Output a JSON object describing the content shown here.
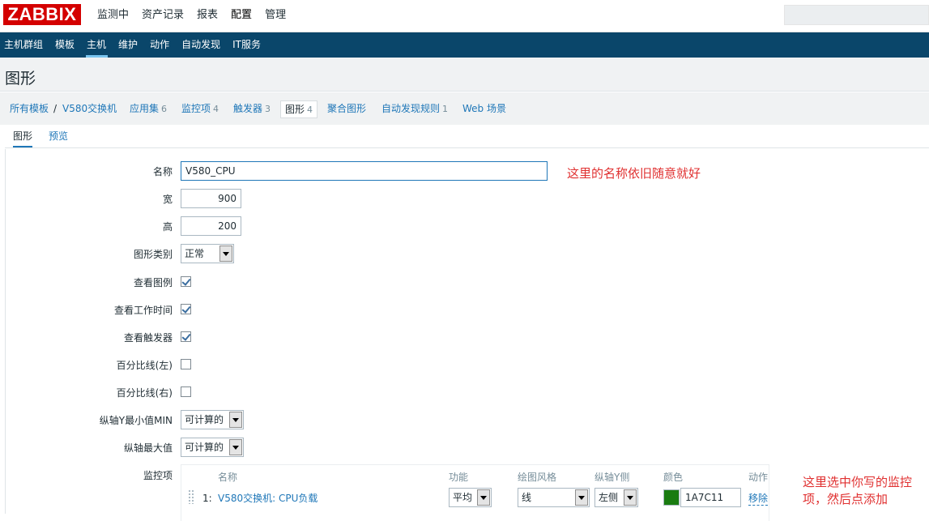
{
  "brand": "ZABBIX",
  "main_menu": [
    "监测中",
    "资产记录",
    "报表",
    "配置",
    "管理"
  ],
  "main_menu_active": "配置",
  "sub_menu": [
    "主机群组",
    "模板",
    "主机",
    "维护",
    "动作",
    "自动发现",
    "IT服务"
  ],
  "sub_menu_active": "主机",
  "page_title": "图形",
  "nav": {
    "all_templates": "所有模板",
    "separator": "/",
    "host": "V580交换机",
    "applications": {
      "label": "应用集",
      "count": "6"
    },
    "items": {
      "label": "监控项",
      "count": "4"
    },
    "triggers": {
      "label": "触发器",
      "count": "3"
    },
    "graphs": {
      "label": "图形",
      "count": "4"
    },
    "screens": "聚合图形",
    "discovery": {
      "label": "自动发现规则",
      "count": "1"
    },
    "web": "Web 场景"
  },
  "tabs": {
    "graph": "图形",
    "preview": "预览"
  },
  "form": {
    "name_label": "名称",
    "name_value": "V580_CPU",
    "width_label": "宽",
    "width_value": "900",
    "height_label": "高",
    "height_value": "200",
    "graph_type_label": "图形类别",
    "graph_type_value": "正常",
    "show_legend_label": "查看图例",
    "show_legend": true,
    "show_worktime_label": "查看工作时间",
    "show_worktime": true,
    "show_triggers_label": "查看触发器",
    "show_triggers": true,
    "percentile_left_label": "百分比线(左)",
    "percentile_left": false,
    "percentile_right_label": "百分比线(右)",
    "percentile_right": false,
    "ymin_label": "纵轴Y最小值MIN",
    "ymin_value": "可计算的",
    "ymax_label": "纵轴最大值",
    "ymax_value": "可计算的",
    "items_label": "监控项"
  },
  "items_table": {
    "headers": {
      "name": "名称",
      "function": "功能",
      "draw_style": "绘图风格",
      "y_axis": "纵轴Y侧",
      "color": "颜色",
      "action": "动作"
    },
    "rows": [
      {
        "index": "1:",
        "name": "V580交换机: CPU负载",
        "function": "平均",
        "draw_style": "线",
        "y_axis": "左侧",
        "color": "1A7C11",
        "color_hex": "#1A7C11",
        "action": "移除"
      }
    ]
  },
  "annotations": {
    "name_note": "这里的名称依旧随意就好",
    "items_note_line1": "这里选中你写的监控",
    "items_note_line2": "项，然后点添加"
  },
  "colors": {
    "brand_red": "#d40000",
    "submenu_bg": "#0a466a",
    "link": "#1f77b8",
    "note_red": "#e03030"
  }
}
